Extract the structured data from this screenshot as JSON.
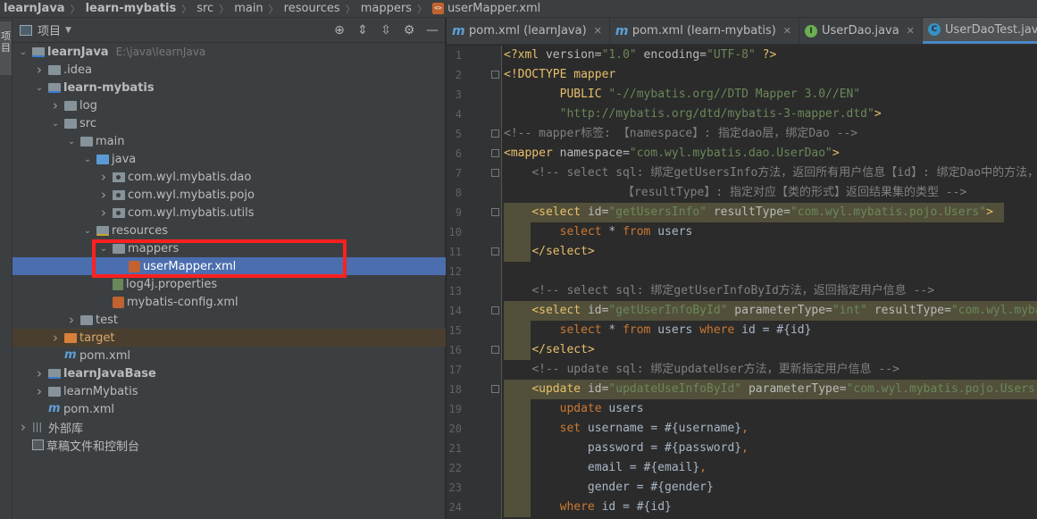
{
  "breadcrumb": [
    "learnJava",
    "learn-mybatis",
    "src",
    "main",
    "resources",
    "mappers",
    "userMapper.xml"
  ],
  "toolstrip": {
    "label": "项目"
  },
  "panel": {
    "title": "项目",
    "icons": [
      "crosshair-icon",
      "expand-all-icon",
      "collapse-all-icon",
      "gear-icon",
      "minimize-icon"
    ]
  },
  "tree": [
    {
      "label": "learnJava",
      "path": "E:\\java\\learnJava",
      "depth": 0,
      "arrow": "open",
      "icon": "module",
      "bold": true
    },
    {
      "label": ".idea",
      "depth": 1,
      "arrow": "closed",
      "icon": "folder"
    },
    {
      "label": "learn-mybatis",
      "depth": 1,
      "arrow": "open",
      "icon": "module",
      "bold": true
    },
    {
      "label": "log",
      "depth": 2,
      "arrow": "closed",
      "icon": "folder"
    },
    {
      "label": "src",
      "depth": 2,
      "arrow": "open",
      "icon": "folder"
    },
    {
      "label": "main",
      "depth": 3,
      "arrow": "open",
      "icon": "folder"
    },
    {
      "label": "java",
      "depth": 4,
      "arrow": "open",
      "icon": "blue"
    },
    {
      "label": "com.wyl.mybatis.dao",
      "depth": 5,
      "arrow": "closed",
      "icon": "pkg"
    },
    {
      "label": "com.wyl.mybatis.pojo",
      "depth": 5,
      "arrow": "closed",
      "icon": "pkg"
    },
    {
      "label": "com.wyl.mybatis.utils",
      "depth": 5,
      "arrow": "closed",
      "icon": "pkg"
    },
    {
      "label": "resources",
      "depth": 4,
      "arrow": "open",
      "icon": "res"
    },
    {
      "label": "mappers",
      "depth": 5,
      "arrow": "open",
      "icon": "folder"
    },
    {
      "label": "userMapper.xml",
      "depth": 6,
      "arrow": "none",
      "icon": "xml",
      "selected": true
    },
    {
      "label": "log4j.properties",
      "depth": 5,
      "arrow": "none",
      "icon": "props"
    },
    {
      "label": "mybatis-config.xml",
      "depth": 5,
      "arrow": "none",
      "icon": "xml"
    },
    {
      "label": "test",
      "depth": 3,
      "arrow": "closed",
      "icon": "folder"
    },
    {
      "label": "target",
      "depth": 2,
      "arrow": "closed",
      "icon": "orange",
      "excluded": true,
      "orange": true
    },
    {
      "label": "pom.xml",
      "depth": 2,
      "arrow": "none",
      "icon": "maven"
    },
    {
      "label": "learnJavaBase",
      "depth": 1,
      "arrow": "closed",
      "icon": "module",
      "bold": true
    },
    {
      "label": "learnMybatis",
      "depth": 1,
      "arrow": "closed",
      "icon": "folder"
    },
    {
      "label": "pom.xml",
      "depth": 1,
      "arrow": "none",
      "icon": "maven"
    },
    {
      "label": "外部库",
      "depth": 0,
      "arrow": "closed",
      "icon": "lib"
    },
    {
      "label": "草稿文件和控制台",
      "depth": 0,
      "arrow": "none",
      "icon": "scratch"
    }
  ],
  "tabs": [
    {
      "label": "pom.xml (learnJava)",
      "icon": "m",
      "active": false
    },
    {
      "label": "pom.xml (learn-mybatis)",
      "icon": "m",
      "active": false
    },
    {
      "label": "UserDao.java",
      "icon": "i",
      "active": false
    },
    {
      "label": "UserDaoTest.java",
      "icon": "c",
      "active": true
    },
    {
      "label": "",
      "icon": "c",
      "active": false
    }
  ],
  "code": [
    {
      "n": 1,
      "parts": [
        [
          "pi",
          "<?xml "
        ],
        [
          "attr",
          "version="
        ],
        [
          "str",
          "\"1.0\""
        ],
        [
          "attr",
          " encoding="
        ],
        [
          "str",
          "\"UTF-8\""
        ],
        [
          "pi",
          " ?>"
        ]
      ]
    },
    {
      "n": 2,
      "parts": [
        [
          "tag",
          "<!DOCTYPE mapper"
        ]
      ]
    },
    {
      "n": 3,
      "parts": [
        [
          "txt",
          "        "
        ],
        [
          "tag",
          "PUBLIC "
        ],
        [
          "str",
          "\"-//mybatis.org//DTD Mapper 3.0//EN\""
        ]
      ]
    },
    {
      "n": 4,
      "parts": [
        [
          "txt",
          "        "
        ],
        [
          "str",
          "\"http://mybatis.org/dtd/mybatis-3-mapper.dtd\""
        ],
        [
          "tag",
          ">"
        ]
      ]
    },
    {
      "n": 5,
      "parts": [
        [
          "cmt",
          "<!-- mapper标签: 【namespace】: 指定dao层，绑定Dao -->"
        ]
      ]
    },
    {
      "n": 6,
      "parts": [
        [
          "tag",
          "<mapper "
        ],
        [
          "attr",
          "namespace="
        ],
        [
          "str",
          "\"com.wyl.mybatis.dao.UserDao\""
        ],
        [
          "tag",
          ">"
        ]
      ]
    },
    {
      "n": 7,
      "parts": [
        [
          "txt",
          "    "
        ],
        [
          "cmt",
          "<!-- select sql: 绑定getUsersInfo方法，返回所有用户信息【id】: 绑定Dao中的方法，"
        ]
      ]
    },
    {
      "n": 8,
      "parts": [
        [
          "cmt",
          "                 【resultType】: 指定对应【类的形式】返回结果集的类型 -->"
        ]
      ]
    },
    {
      "n": 9,
      "parts": [
        [
          "txt",
          "    "
        ],
        [
          "tag",
          "<select "
        ],
        [
          "attr",
          "id="
        ],
        [
          "str",
          "\"getUsersInfo\""
        ],
        [
          "attr",
          " resultType="
        ],
        [
          "str",
          "\"com.wyl.mybatis.pojo.Users\""
        ],
        [
          "tag",
          ">"
        ]
      ]
    },
    {
      "n": 10,
      "parts": [
        [
          "txt",
          "        "
        ],
        [
          "kw",
          "select"
        ],
        [
          "txt",
          " * "
        ],
        [
          "kw",
          "from"
        ],
        [
          "txt",
          " users"
        ]
      ]
    },
    {
      "n": 11,
      "parts": [
        [
          "txt",
          "    "
        ],
        [
          "tag",
          "</select>"
        ]
      ]
    },
    {
      "n": 12,
      "parts": []
    },
    {
      "n": 13,
      "parts": [
        [
          "txt",
          "    "
        ],
        [
          "cmt",
          "<!-- select sql: 绑定getUserInfoById方法，返回指定用户信息 -->"
        ]
      ]
    },
    {
      "n": 14,
      "parts": [
        [
          "txt",
          "    "
        ],
        [
          "tag",
          "<select "
        ],
        [
          "attr",
          "id="
        ],
        [
          "str",
          "\"getUserInfoById\""
        ],
        [
          "attr",
          " parameterType="
        ],
        [
          "str",
          "\"int\""
        ],
        [
          "attr",
          " resultType="
        ],
        [
          "str",
          "\"com.wyl.mybatis.pojo.Users\""
        ]
      ]
    },
    {
      "n": 15,
      "parts": [
        [
          "txt",
          "        "
        ],
        [
          "kw",
          "select"
        ],
        [
          "txt",
          " * "
        ],
        [
          "kw",
          "from"
        ],
        [
          "txt",
          " users "
        ],
        [
          "kw",
          "where"
        ],
        [
          "txt",
          " id = #{id}"
        ]
      ]
    },
    {
      "n": 16,
      "parts": [
        [
          "txt",
          "    "
        ],
        [
          "tag",
          "</select>"
        ]
      ]
    },
    {
      "n": 17,
      "parts": [
        [
          "txt",
          "    "
        ],
        [
          "cmt",
          "<!-- update sql: 绑定updateUser方法，更新指定用户信息 -->"
        ]
      ]
    },
    {
      "n": 18,
      "parts": [
        [
          "txt",
          "    "
        ],
        [
          "tag",
          "<update "
        ],
        [
          "attr",
          "id="
        ],
        [
          "str",
          "\"updateUseInfoById\""
        ],
        [
          "attr",
          " parameterType="
        ],
        [
          "str",
          "\"com.wyl.mybatis.pojo.Users\""
        ]
      ]
    },
    {
      "n": 19,
      "parts": [
        [
          "txt",
          "        "
        ],
        [
          "kw",
          "update"
        ],
        [
          "txt",
          " users"
        ]
      ]
    },
    {
      "n": 20,
      "parts": [
        [
          "txt",
          "        "
        ],
        [
          "kw",
          "set"
        ],
        [
          "txt",
          " username = #{username}"
        ],
        [
          "kw",
          ","
        ]
      ]
    },
    {
      "n": 21,
      "parts": [
        [
          "txt",
          "            password = #{password}"
        ],
        [
          "kw",
          ","
        ]
      ]
    },
    {
      "n": 22,
      "parts": [
        [
          "txt",
          "            email = #{email}"
        ],
        [
          "kw",
          ","
        ]
      ]
    },
    {
      "n": 23,
      "parts": [
        [
          "txt",
          "            gender = #{gender}"
        ]
      ]
    },
    {
      "n": 24,
      "parts": [
        [
          "txt",
          "        "
        ],
        [
          "kw",
          "where"
        ],
        [
          "txt",
          " id = #{id}"
        ]
      ]
    }
  ]
}
